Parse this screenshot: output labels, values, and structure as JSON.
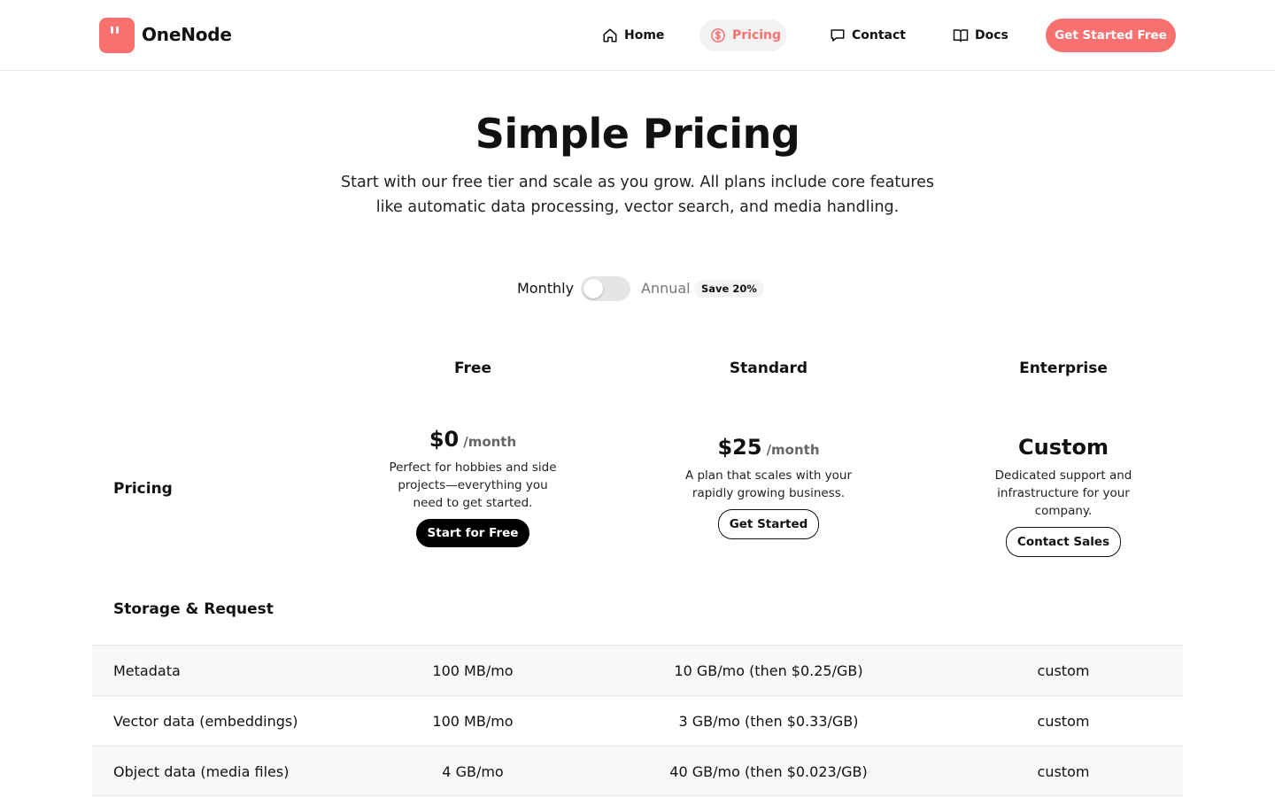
{
  "brand": {
    "name": "OneNode",
    "accent": "#f87171"
  },
  "nav": {
    "home": "Home",
    "pricing": "Pricing",
    "contact": "Contact",
    "docs": "Docs",
    "active": "Pricing",
    "cta": "Get Started Free"
  },
  "hero": {
    "title": "Simple Pricing",
    "subtitle": "Start with our free tier and scale as you grow. All plans include core features like automatic data processing, vector search, and media handling."
  },
  "billing": {
    "monthly": "Monthly",
    "annual": "Annual",
    "save_badge": "Save 20%",
    "annual_selected": false
  },
  "plans": {
    "row_label": "Pricing",
    "free": {
      "name": "Free",
      "price": "$0",
      "unit": "/month",
      "description": "Perfect for hobbies and side projects—everything you need to get started.",
      "button": "Start for Free"
    },
    "standard": {
      "name": "Standard",
      "price": "$25",
      "unit": "/month",
      "description": "A plan that scales with your rapidly growing business.",
      "button": "Get Started"
    },
    "enterprise": {
      "name": "Enterprise",
      "price": "Custom",
      "description": "Dedicated support and infrastructure for your company.",
      "button": "Contact Sales"
    }
  },
  "storage": {
    "section_title": "Storage & Request",
    "rows": [
      {
        "label": "Metadata",
        "free": "100 MB/mo",
        "standard": "10 GB/mo (then $0.25/GB)",
        "enterprise": "custom"
      },
      {
        "label": "Vector data (embeddings)",
        "free": "100 MB/mo",
        "standard": "3 GB/mo (then $0.33/GB)",
        "enterprise": "custom"
      },
      {
        "label": "Object data (media files)",
        "free": "4 GB/mo",
        "standard": "40 GB/mo (then $0.023/GB)",
        "enterprise": "custom"
      }
    ]
  }
}
